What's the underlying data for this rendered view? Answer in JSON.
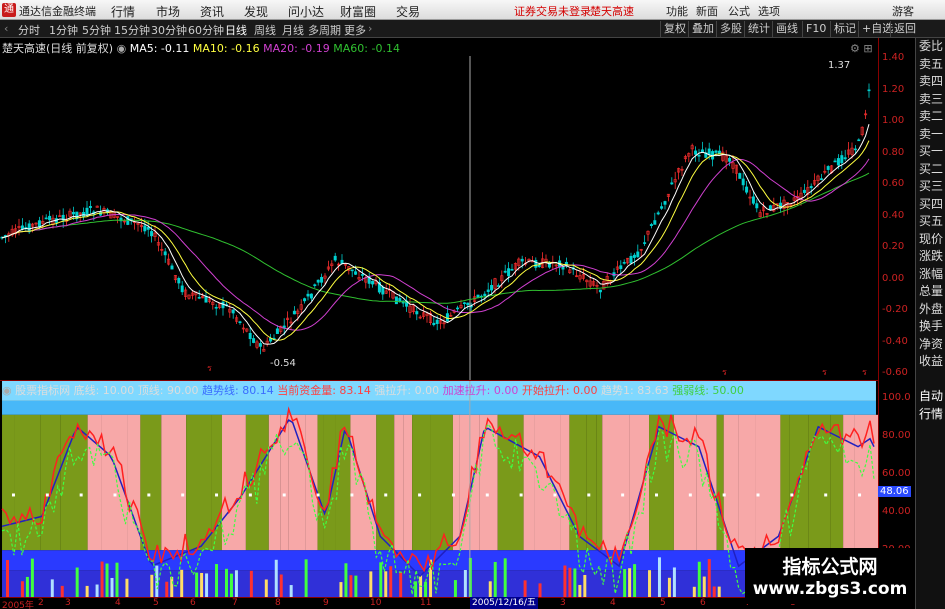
{
  "titlebar": {
    "app_name": "通达信金融终端",
    "menus": [
      "行情",
      "市场",
      "资讯",
      "发现",
      "问小达",
      "财富圈",
      "交易"
    ],
    "warning": "证券交易未登录",
    "stock_name": "楚天高速",
    "right_items": [
      "功能",
      "新面",
      "公式",
      "选项"
    ],
    "user": "游客"
  },
  "toolbar": {
    "periods": [
      "分时",
      "1分钟",
      "5分钟",
      "15分钟",
      "30分钟",
      "60分钟",
      "日线",
      "周线",
      "月线",
      "多周期",
      "更多"
    ],
    "active_period": "日线",
    "right_buttons": [
      "复权",
      "叠加",
      "多股",
      "统计",
      "画线",
      "F10",
      "标记",
      "+自选",
      "返回"
    ]
  },
  "kline_header": {
    "title": "楚天高速(日线 前复权)",
    "ma5": "MA5: -0.11",
    "ma10": "MA10: -0.16",
    "ma20": "MA20: -0.19",
    "ma60": "MA60: -0.14"
  },
  "kline_annotations": {
    "high": "1.37",
    "low": "-0.54"
  },
  "kline_axis": [
    "1.40",
    "1.20",
    "1.00",
    "0.80",
    "0.60",
    "0.40",
    "0.20",
    "0.00",
    "-0.20",
    "-0.40",
    "-0.60"
  ],
  "indicator_header": {
    "name": "股票指标网",
    "items": [
      {
        "text": "底线: 10.00",
        "color": "#dddddd"
      },
      {
        "text": "顶线: 90.00",
        "color": "#dddddd"
      },
      {
        "text": "趋势线: 80.14",
        "color": "#3a6cff"
      },
      {
        "text": "当前资金量: 83.14",
        "color": "#ff4040"
      },
      {
        "text": "强拉升: 0.00",
        "color": "#dddddd"
      },
      {
        "text": "加速拉升: 0.00",
        "color": "#d040d0"
      },
      {
        "text": "开始拉升: 0.00",
        "color": "#ff4040"
      },
      {
        "text": "趋势1: 83.63",
        "color": "#dddddd"
      },
      {
        "text": "强弱线: 50.00",
        "color": "#40d040"
      }
    ]
  },
  "indicator_axis": [
    "100.0",
    "80.00",
    "60.00",
    "40.00",
    "20.00"
  ],
  "indicator_cursor_value": "48.06",
  "dates": [
    "2005年",
    "2",
    "3",
    "4",
    "5",
    "6",
    "7",
    "8",
    "9",
    "10",
    "11",
    "12",
    "2",
    "3",
    "4",
    "5",
    "6",
    "7",
    "8"
  ],
  "date_cursor": "2005/12/16/五",
  "side_panel": [
    "委比",
    "卖五",
    "卖四",
    "卖三",
    "卖二",
    "卖一",
    "买一",
    "买二",
    "买三",
    "买四",
    "买五",
    "现价",
    "涨跌",
    "涨幅",
    "总量",
    "外盘",
    "换手",
    "净资",
    "收益",
    "",
    "自动",
    "行情"
  ],
  "watermark": {
    "line1": "指标公式网",
    "line2": "www.zbgs3.com"
  },
  "colors": {
    "up": "#ff3030",
    "down": "#00d0d0",
    "ma5": "#ffffff",
    "ma10": "#ffff40",
    "ma20": "#d040d0",
    "ma60": "#30c030",
    "axis": "#cc2222"
  }
}
